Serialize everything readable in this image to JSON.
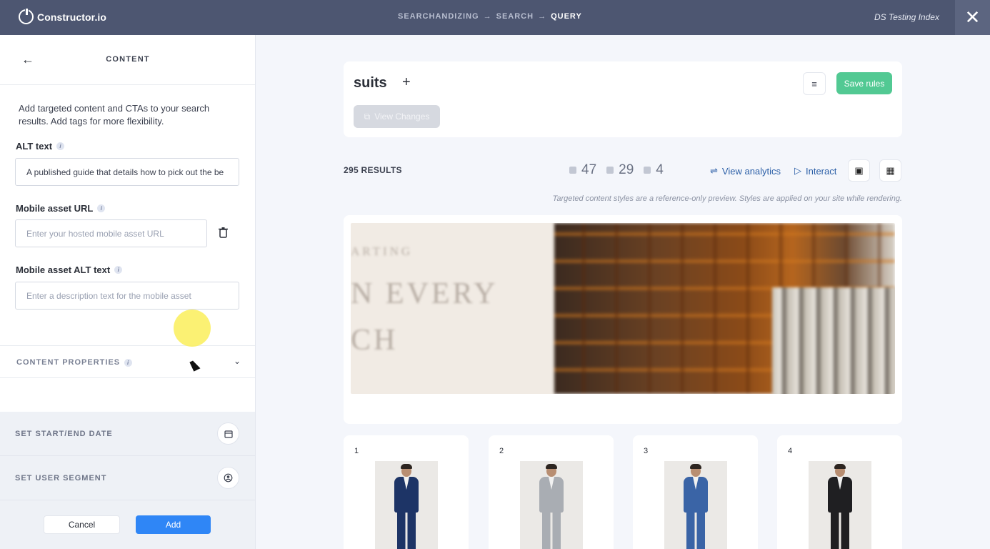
{
  "topbar": {
    "brand": "Constructor.io",
    "breadcrumbs": [
      "SEARCHANDIZING",
      "SEARCH",
      "QUERY"
    ],
    "index_name": "DS Testing Index",
    "close_icon": "close-icon"
  },
  "panel": {
    "title": "CONTENT",
    "intro": "Add targeted content and CTAs to your search results. Add tags for more flexibility.",
    "alt_text_label": "ALT text",
    "alt_text_value": "A published guide that details how to pick out the be",
    "mobile_url_label": "Mobile asset URL",
    "mobile_url_placeholder": "Enter your hosted mobile asset URL",
    "mobile_alt_label": "Mobile asset ALT text",
    "mobile_alt_placeholder": "Enter a description text for the mobile asset",
    "content_properties": "CONTENT PROPERTIES",
    "set_date": "SET START/END DATE",
    "set_segment": "SET USER SEGMENT",
    "cancel": "Cancel",
    "add": "Add"
  },
  "query": {
    "term": "suits",
    "view_changes": "View Changes",
    "save_rules": "Save rules"
  },
  "results": {
    "count_label": "295 RESULTS",
    "stats": [
      "47",
      "29",
      "4"
    ],
    "view_analytics": "View analytics",
    "interact": "Interact",
    "note": "Targeted content styles are a reference-only preview. Styles are applied on your site while rendering."
  },
  "banner": {
    "lines": [
      "ARTING",
      "N EVERY",
      "CH"
    ]
  },
  "products": [
    {
      "rank": "1",
      "suit_color": "#1d3466"
    },
    {
      "rank": "2",
      "suit_color": "#a9adb3"
    },
    {
      "rank": "3",
      "suit_color": "#3a64a6"
    },
    {
      "rank": "4",
      "suit_color": "#1f1f22"
    }
  ],
  "colors": {
    "topbar": "#4d5671",
    "save_rules": "#52c993",
    "add_button": "#2f86f6",
    "link": "#2b5fa7"
  }
}
